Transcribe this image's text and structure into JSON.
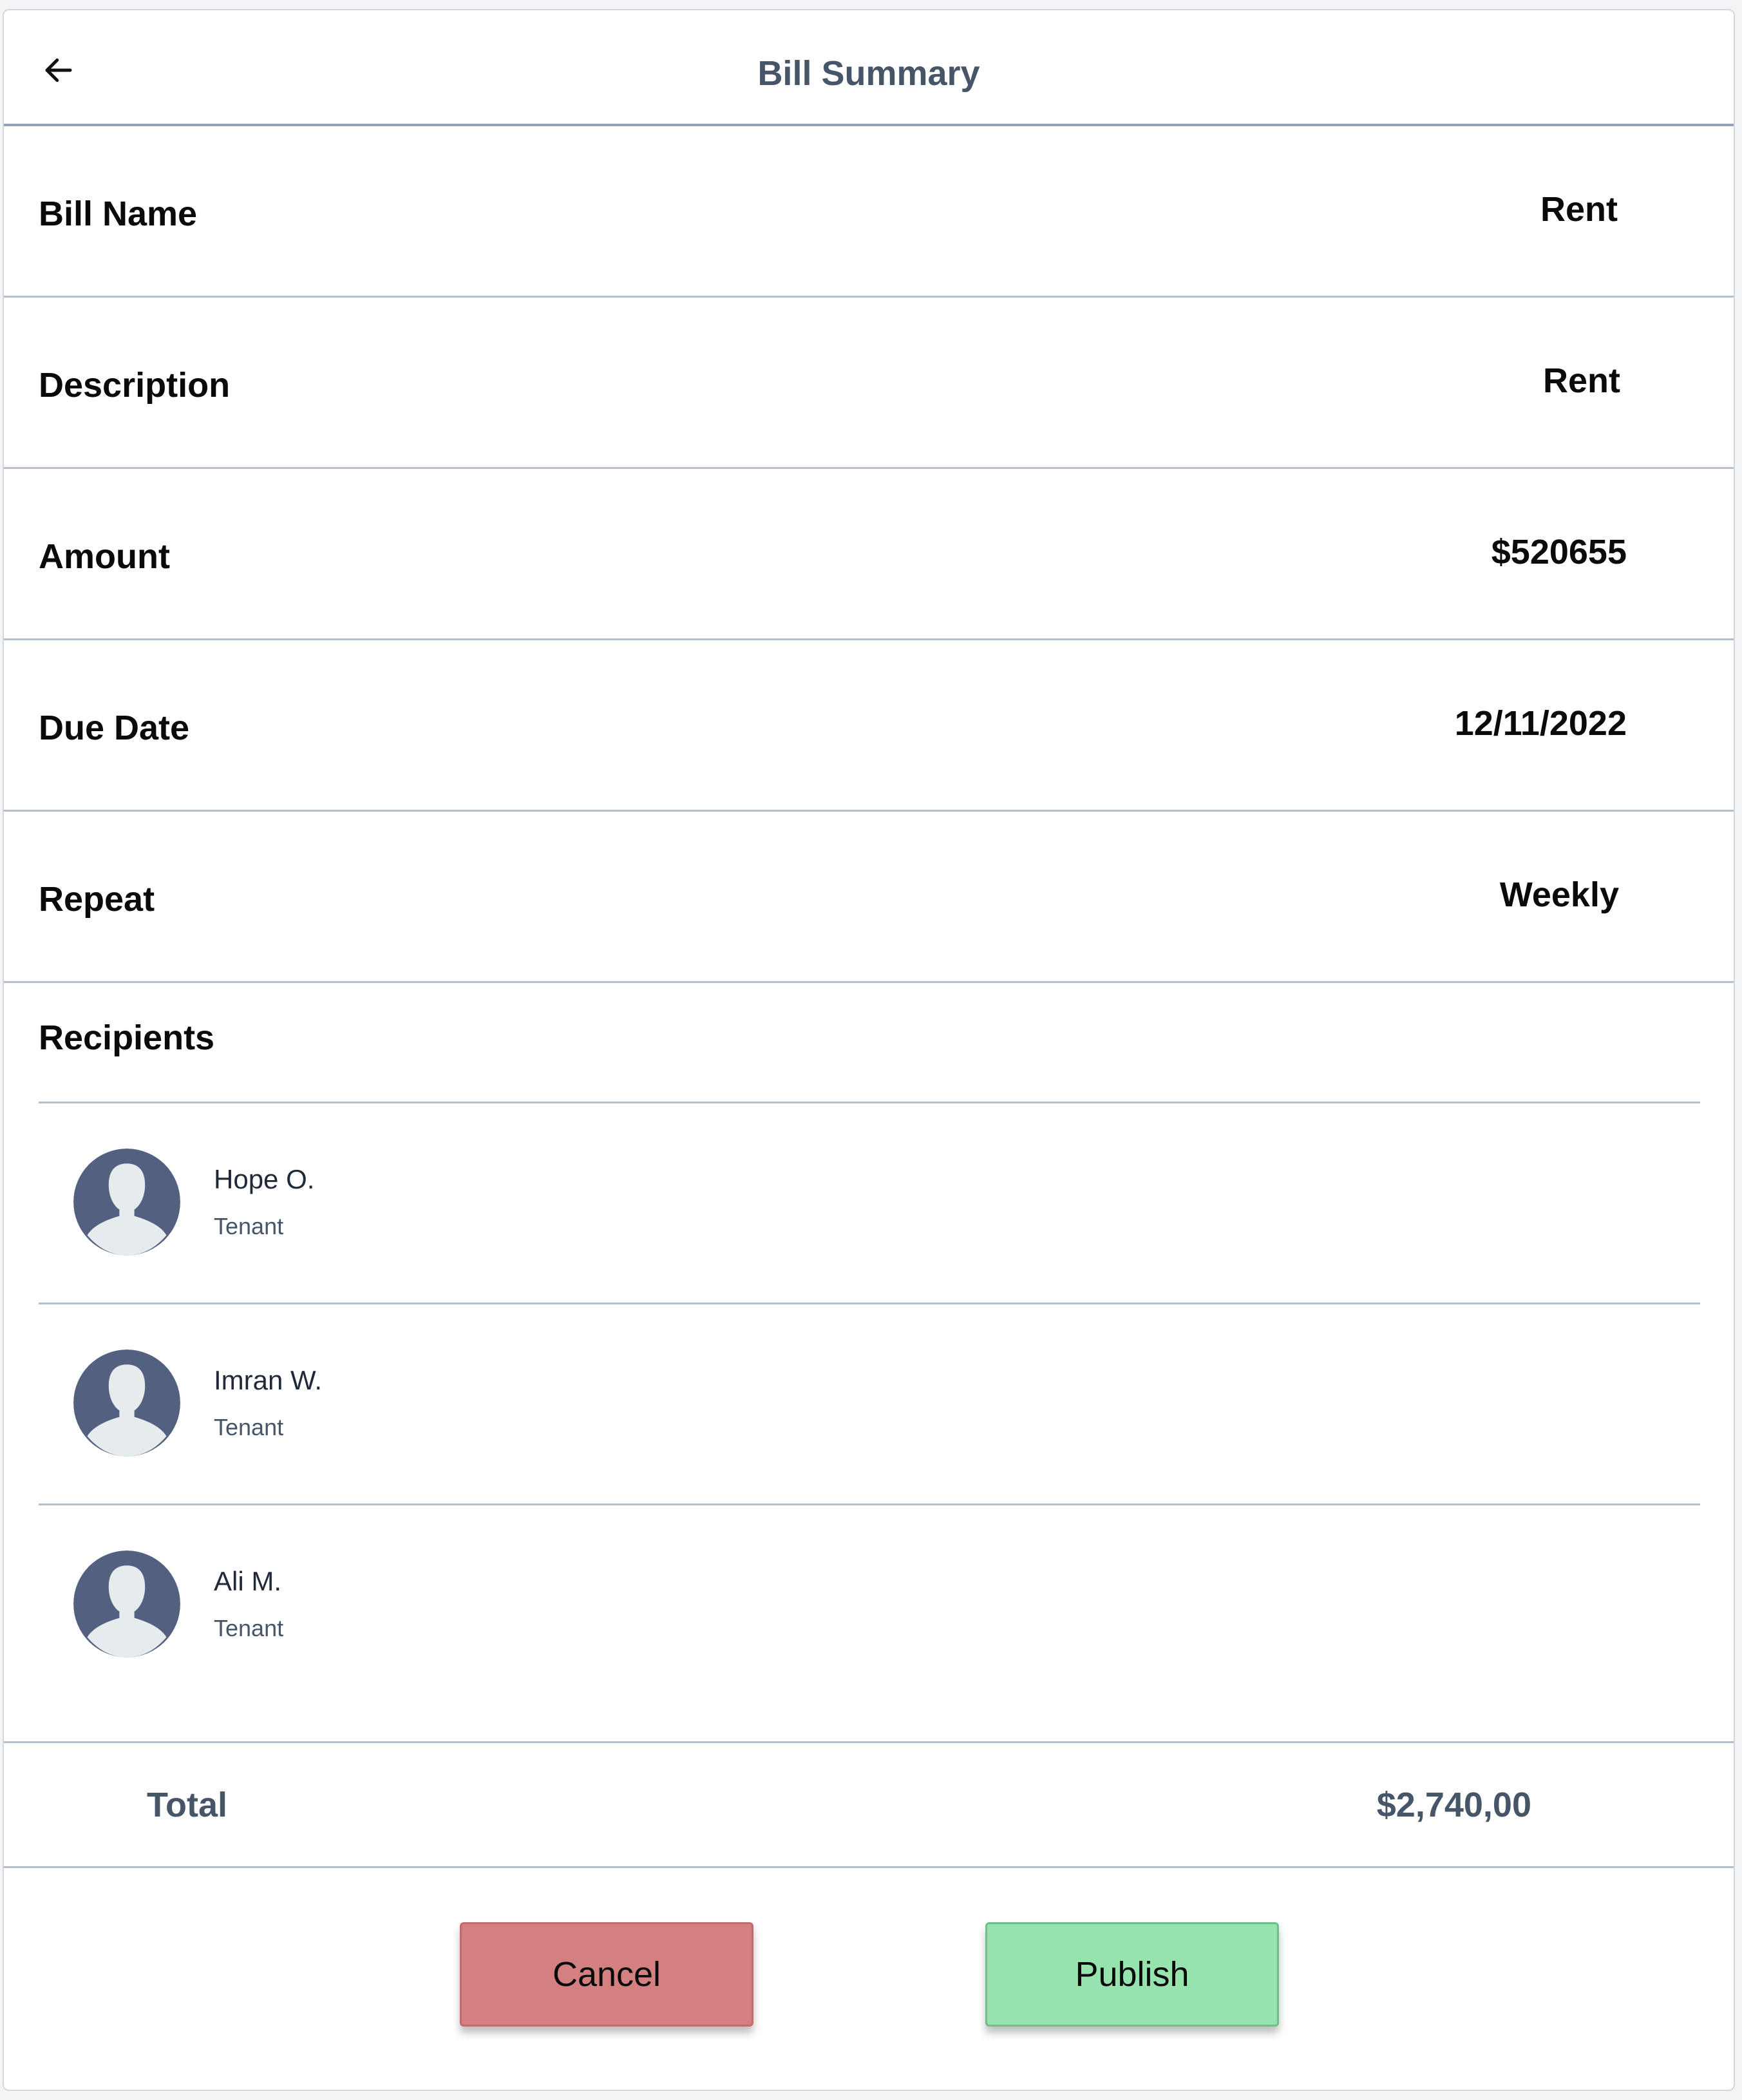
{
  "header": {
    "title": "Bill Summary"
  },
  "fields": [
    {
      "label": "Bill Name",
      "value": "Rent"
    },
    {
      "label": "Description",
      "value": "Rent"
    },
    {
      "label": "Amount",
      "value": "$520655"
    },
    {
      "label": "Due Date",
      "value": "12/11/2022"
    },
    {
      "label": "Repeat",
      "value": "Weekly"
    }
  ],
  "recipients": {
    "title": "Recipients",
    "items": [
      {
        "name": "Hope O.",
        "role": "Tenant"
      },
      {
        "name": "Imran W.",
        "role": "Tenant"
      },
      {
        "name": "Ali M.",
        "role": "Tenant"
      }
    ]
  },
  "total": {
    "label": "Total",
    "value": "$2,740,00"
  },
  "actions": {
    "cancel_label": "Cancel",
    "publish_label": "Publish"
  },
  "colors": {
    "cancel": "#d58080",
    "publish": "#96e3ae",
    "avatar_bg": "#546080",
    "avatar_silhouette": "#e6ebee",
    "divider": "#b5c0cf",
    "muted_text": "#475569"
  },
  "icons": {
    "back": "arrow-left-icon",
    "avatar": "user-silhouette-icon"
  }
}
